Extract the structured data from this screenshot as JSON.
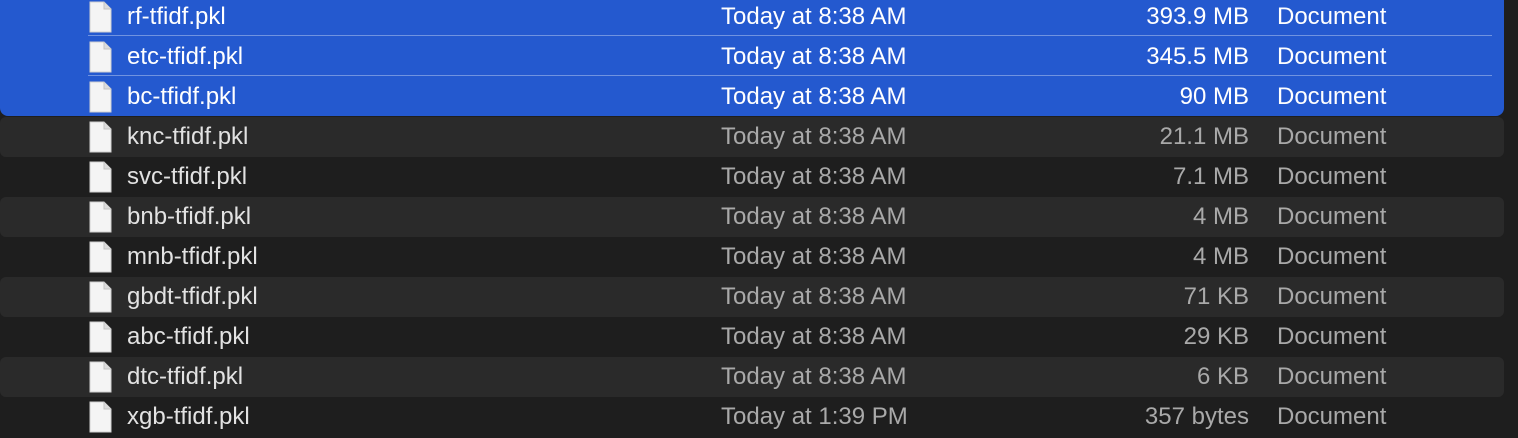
{
  "colors": {
    "selection": "#2459cf",
    "alt_row": "#2a2a2a",
    "background": "#1e1e1e"
  },
  "files": [
    {
      "name": "rf-tfidf.pkl",
      "date": "Today at 8:38 AM",
      "size": "393.9 MB",
      "kind": "Document",
      "selected": true,
      "icon": "document-icon"
    },
    {
      "name": "etc-tfidf.pkl",
      "date": "Today at 8:38 AM",
      "size": "345.5 MB",
      "kind": "Document",
      "selected": true,
      "icon": "document-icon"
    },
    {
      "name": "bc-tfidf.pkl",
      "date": "Today at 8:38 AM",
      "size": "90 MB",
      "kind": "Document",
      "selected": true,
      "icon": "document-icon"
    },
    {
      "name": "knc-tfidf.pkl",
      "date": "Today at 8:38 AM",
      "size": "21.1 MB",
      "kind": "Document",
      "selected": false,
      "icon": "document-icon"
    },
    {
      "name": "svc-tfidf.pkl",
      "date": "Today at 8:38 AM",
      "size": "7.1 MB",
      "kind": "Document",
      "selected": false,
      "icon": "document-icon"
    },
    {
      "name": "bnb-tfidf.pkl",
      "date": "Today at 8:38 AM",
      "size": "4 MB",
      "kind": "Document",
      "selected": false,
      "icon": "document-icon"
    },
    {
      "name": "mnb-tfidf.pkl",
      "date": "Today at 8:38 AM",
      "size": "4 MB",
      "kind": "Document",
      "selected": false,
      "icon": "document-icon"
    },
    {
      "name": "gbdt-tfidf.pkl",
      "date": "Today at 8:38 AM",
      "size": "71 KB",
      "kind": "Document",
      "selected": false,
      "icon": "document-icon"
    },
    {
      "name": "abc-tfidf.pkl",
      "date": "Today at 8:38 AM",
      "size": "29 KB",
      "kind": "Document",
      "selected": false,
      "icon": "document-icon"
    },
    {
      "name": "dtc-tfidf.pkl",
      "date": "Today at 8:38 AM",
      "size": "6 KB",
      "kind": "Document",
      "selected": false,
      "icon": "document-icon"
    },
    {
      "name": "xgb-tfidf.pkl",
      "date": "Today at 1:39 PM",
      "size": "357 bytes",
      "kind": "Document",
      "selected": false,
      "icon": "document-icon"
    }
  ]
}
